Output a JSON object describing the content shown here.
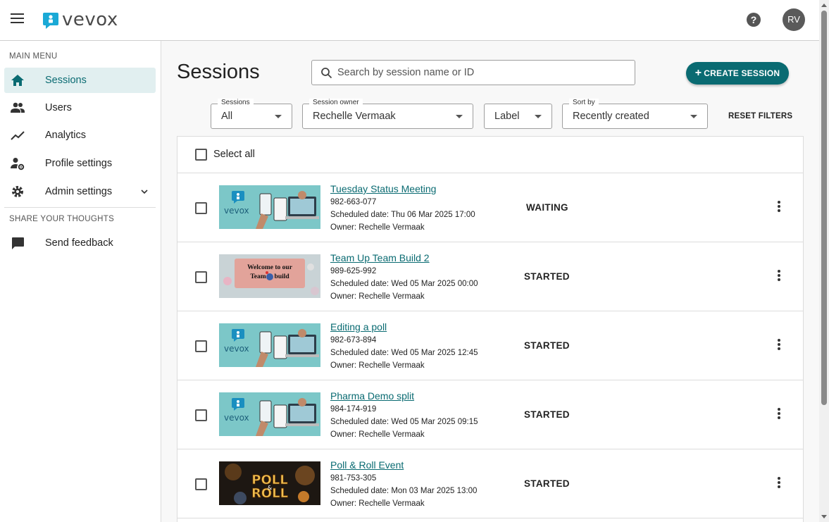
{
  "app": {
    "logo_text": "vevox",
    "avatar_initials": "RV",
    "help_label": "?"
  },
  "sidebar": {
    "main_menu_heading": "MAIN MENU",
    "items": [
      {
        "label": "Sessions",
        "icon": "home-icon",
        "active": true
      },
      {
        "label": "Users",
        "icon": "users-icon"
      },
      {
        "label": "Analytics",
        "icon": "analytics-icon"
      },
      {
        "label": "Profile settings",
        "icon": "profile-settings-icon"
      },
      {
        "label": "Admin settings",
        "icon": "gear-icon"
      }
    ],
    "share_heading": "SHARE YOUR THOUGHTS",
    "feedback_label": "Send feedback"
  },
  "main": {
    "title": "Sessions",
    "search_placeholder": "Search by session name or ID",
    "create_label": "CREATE SESSION",
    "create_plus": "+",
    "filters": {
      "sessions": {
        "label": "Sessions",
        "value": "All"
      },
      "owner": {
        "label": "Session owner",
        "value": "Rechelle Vermaak"
      },
      "label": {
        "value": "Label"
      },
      "sort": {
        "label": "Sort by",
        "value": "Recently created"
      }
    },
    "reset_label": "RESET FILTERS",
    "select_all_label": "Select all"
  },
  "sessions": [
    {
      "title": "Tuesday Status Meeting",
      "id": "982-663-077",
      "scheduled": "Scheduled date: Thu 06 Mar 2025 17:00",
      "owner": "Owner: Rechelle Vermaak",
      "status": "WAITING",
      "thumb": "vevox"
    },
    {
      "title": "Team Up Team Build 2",
      "id": "989-625-992",
      "scheduled": "Scheduled date: Wed 05 Mar 2025 00:00",
      "owner": "Owner: Rechelle Vermaak",
      "status": "STARTED",
      "thumb": "team",
      "thumb_text": "Welcome to our Team build"
    },
    {
      "title": "Editing a poll",
      "id": "982-673-894",
      "scheduled": "Scheduled date: Wed 05 Mar 2025 12:45",
      "owner": "Owner: Rechelle Vermaak",
      "status": "STARTED",
      "thumb": "vevox"
    },
    {
      "title": "Pharma Demo split",
      "id": "984-174-919",
      "scheduled": "Scheduled date: Wed 05 Mar 2025 09:15",
      "owner": "Owner: Rechelle Vermaak",
      "status": "STARTED",
      "thumb": "vevox"
    },
    {
      "title": "Poll & Roll Event",
      "id": "981-753-305",
      "scheduled": "Scheduled date: Mon 03 Mar 2025 13:00",
      "owner": "Owner: Rechelle Vermaak",
      "status": "STARTED",
      "thumb": "poll",
      "thumb_text": "POLL & ROLL"
    }
  ],
  "colors": {
    "accent": "#0a6b72",
    "active_bg": "#e1eff0",
    "thumb_teal": "#7cc7c8"
  }
}
